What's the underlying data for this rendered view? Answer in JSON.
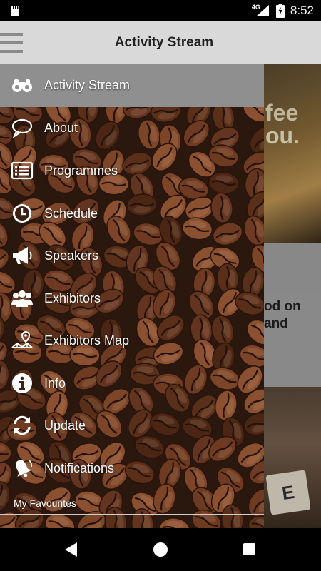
{
  "status_bar": {
    "network": "4G",
    "time": "8:52"
  },
  "app_bar": {
    "title": "Activity Stream"
  },
  "background_content": {
    "card_text_1": "fee",
    "card_text_2": "ou.",
    "card2_text": "od on and",
    "tile_letter": "E"
  },
  "drawer": {
    "items": [
      {
        "label": "Activity Stream",
        "icon": "binoculars-icon",
        "active": true
      },
      {
        "label": "About",
        "icon": "speech-bubble-icon"
      },
      {
        "label": "Programmes",
        "icon": "list-icon"
      },
      {
        "label": "Schedule",
        "icon": "clock-icon"
      },
      {
        "label": "Speakers",
        "icon": "megaphone-icon"
      },
      {
        "label": "Exhibitors",
        "icon": "group-icon"
      },
      {
        "label": "Exhibitors Map",
        "icon": "map-icon"
      },
      {
        "label": "Info",
        "icon": "info-icon"
      },
      {
        "label": "Update",
        "icon": "refresh-icon"
      },
      {
        "label": "Notifications",
        "icon": "bell-icon"
      }
    ],
    "section_label": "My Favourites"
  },
  "colors": {
    "app_bar": "#d9d9d9",
    "active_row": "#8f8f8f",
    "drawer_bg": "#3a2115"
  }
}
